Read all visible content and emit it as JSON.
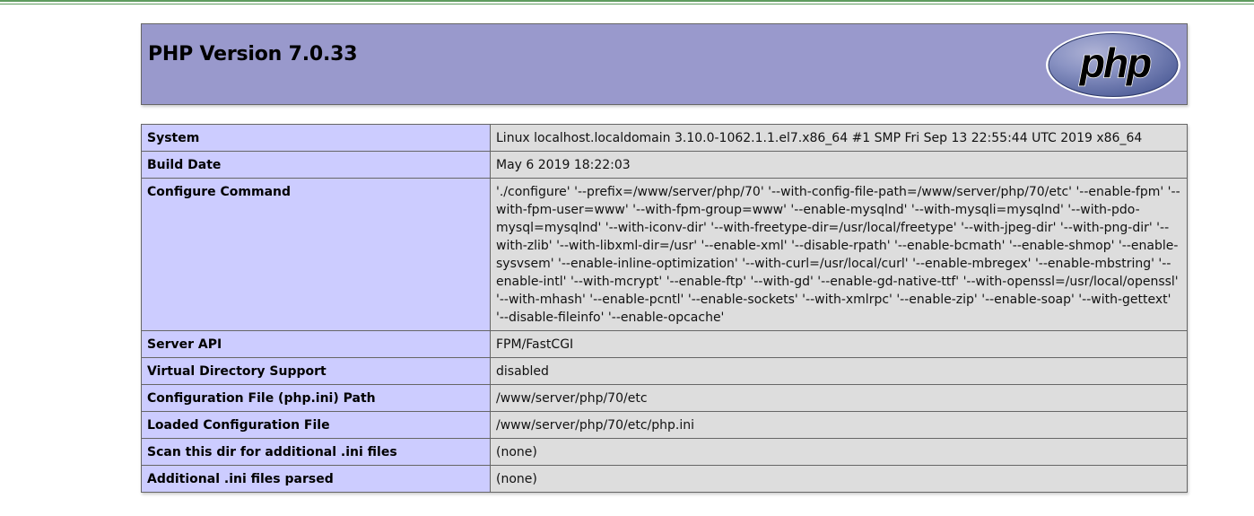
{
  "header": {
    "title": "PHP Version 7.0.33",
    "logo_text": "php",
    "logo_color": "#6c7eb7"
  },
  "colors": {
    "header_bg": "#9999cc",
    "key_cell_bg": "#ccccff",
    "value_cell_bg": "#dddddd",
    "top_line": "#5e9b5e"
  },
  "rows": [
    {
      "key": "System",
      "value": "Linux localhost.localdomain 3.10.0-1062.1.1.el7.x86_64 #1 SMP Fri Sep 13 22:55:44 UTC 2019 x86_64"
    },
    {
      "key": "Build Date",
      "value": "May 6 2019 18:22:03"
    },
    {
      "key": "Configure Command",
      "value": "'./configure' '--prefix=/www/server/php/70' '--with-config-file-path=/www/server/php/70/etc' '--enable-fpm' '--with-fpm-user=www' '--with-fpm-group=www' '--enable-mysqlnd' '--with-mysqli=mysqlnd' '--with-pdo-mysql=mysqlnd' '--with-iconv-dir' '--with-freetype-dir=/usr/local/freetype' '--with-jpeg-dir' '--with-png-dir' '--with-zlib' '--with-libxml-dir=/usr' '--enable-xml' '--disable-rpath' '--enable-bcmath' '--enable-shmop' '--enable-sysvsem' '--enable-inline-optimization' '--with-curl=/usr/local/curl' '--enable-mbregex' '--enable-mbstring' '--enable-intl' '--with-mcrypt' '--enable-ftp' '--with-gd' '--enable-gd-native-ttf' '--with-openssl=/usr/local/openssl' '--with-mhash' '--enable-pcntl' '--enable-sockets' '--with-xmlrpc' '--enable-zip' '--enable-soap' '--with-gettext' '--disable-fileinfo' '--enable-opcache'"
    },
    {
      "key": "Server API",
      "value": "FPM/FastCGI"
    },
    {
      "key": "Virtual Directory Support",
      "value": "disabled"
    },
    {
      "key": "Configuration File (php.ini) Path",
      "value": "/www/server/php/70/etc"
    },
    {
      "key": "Loaded Configuration File",
      "value": "/www/server/php/70/etc/php.ini"
    },
    {
      "key": "Scan this dir for additional .ini files",
      "value": "(none)"
    },
    {
      "key": "Additional .ini files parsed",
      "value": "(none)"
    }
  ]
}
